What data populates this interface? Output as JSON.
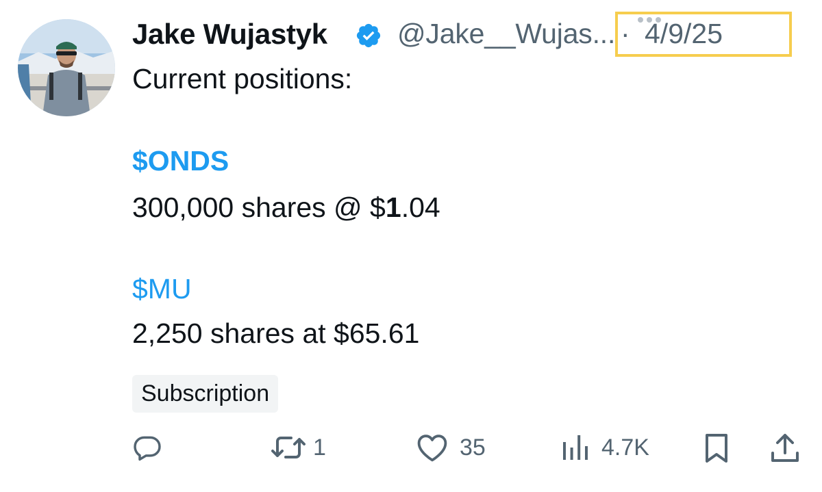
{
  "author": {
    "display_name": "Jake Wujastyk",
    "handle": "@Jake__Wujas...",
    "verified_icon": "verified-badge-icon",
    "timestamp_separator": "·",
    "timestamp": "4/9/25"
  },
  "post": {
    "intro": "Current positions:",
    "positions": [
      {
        "ticker": "$ONDS",
        "prefix": "300,000 shares @ $",
        "bold": "1",
        "suffix": ".04"
      },
      {
        "ticker": "$MU",
        "text": "2,250 shares at $65.61"
      }
    ],
    "tag": "Subscription"
  },
  "actions": {
    "reply": {
      "icon": "reply-icon",
      "count": ""
    },
    "repost": {
      "icon": "repost-icon",
      "count": "1"
    },
    "like": {
      "icon": "heart-icon",
      "count": "35"
    },
    "views": {
      "icon": "views-icon",
      "count": "4.7K"
    },
    "bookmark": {
      "icon": "bookmark-icon"
    },
    "share": {
      "icon": "share-icon"
    }
  },
  "colors": {
    "link": "#1d9bf0",
    "secondary_text": "#536471",
    "highlight_box": "#f6cd4e"
  }
}
